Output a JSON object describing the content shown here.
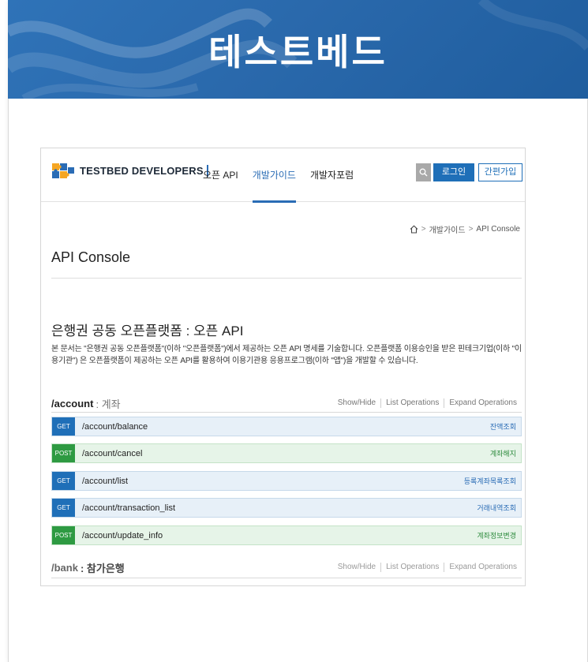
{
  "banner": {
    "title": "테스트베드"
  },
  "nav": {
    "logo_text": "TESTBED DEVELOPERS",
    "items": [
      "오픈 API",
      "개발가이드",
      "개발자포럼"
    ],
    "active_index": 1,
    "login_label": "로그인",
    "join_label": "간편가입",
    "accent_color": "#1f6fb8"
  },
  "breadcrumb": {
    "items": [
      "개발가이드",
      "API Console"
    ]
  },
  "page": {
    "title": "API Console",
    "section_title": "은행권 공동 오픈플랫폼 : 오픈 API",
    "description": "본 문서는 \"은행권 공동 오픈플랫폼\"(이하 \"오픈플랫폼\")에서 제공하는 오픈 API 명세를 기술합니다. 오픈플랫폼 이용승인을 받은 핀테크기업(이하 \"이용기관\") 은 오픈플랫폼이 제공하는 오픈 API를 활용하여 이용기관용 응용프로그램(이하 \"앱\")을 개발할 수 있습니다."
  },
  "groups": [
    {
      "name": "/account",
      "sub": ": 계좌",
      "links": [
        "Show/Hide",
        "List Operations",
        "Expand Operations"
      ],
      "operations": [
        {
          "method": "GET",
          "path": "/account/balance",
          "desc": "잔액조회"
        },
        {
          "method": "POST",
          "path": "/account/cancel",
          "desc": "계좌해지"
        },
        {
          "method": "GET",
          "path": "/account/list",
          "desc": "등록계좌목록조회"
        },
        {
          "method": "GET",
          "path": "/account/transaction_list",
          "desc": "거래내역조회"
        },
        {
          "method": "POST",
          "path": "/account/update_info",
          "desc": "계좌정보변경"
        }
      ]
    },
    {
      "name": "/bank",
      "sub": ": 참가은행",
      "links": [
        "Show/Hide",
        "List Operations",
        "Expand Operations"
      ]
    }
  ],
  "colors": {
    "get": "#1f6fb8",
    "post": "#2e9a42",
    "banner": "#2a69ac"
  }
}
